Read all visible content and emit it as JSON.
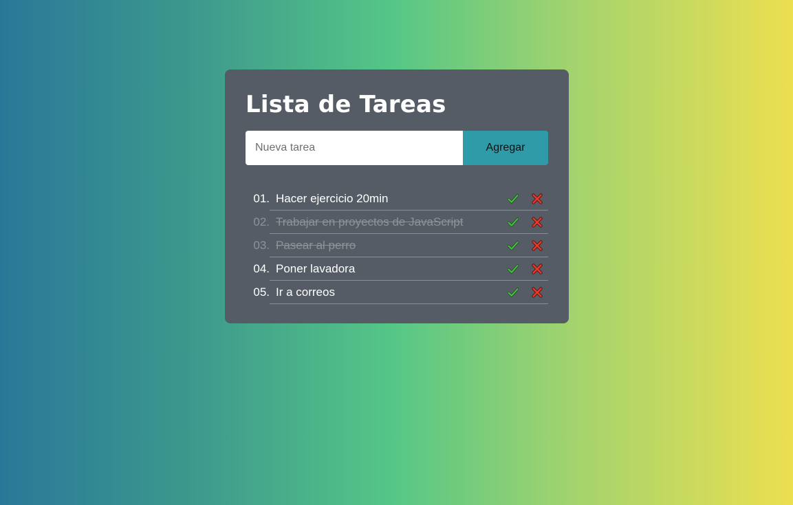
{
  "app": {
    "title": "Lista de Tareas"
  },
  "form": {
    "placeholder": "Nueva tarea",
    "value": "",
    "add_label": "Agregar"
  },
  "tasks": [
    {
      "number": "01.",
      "text": "Hacer ejercicio 20min",
      "done": false
    },
    {
      "number": "02.",
      "text": "Trabajar en proyectos de JavaScript",
      "done": true
    },
    {
      "number": "03.",
      "text": "Pasear al perro",
      "done": true
    },
    {
      "number": "04.",
      "text": "Poner lavadora",
      "done": false
    },
    {
      "number": "05.",
      "text": "Ir a correos",
      "done": false
    }
  ],
  "icons": {
    "complete": "check-icon",
    "delete": "close-icon"
  },
  "colors": {
    "card": "#555c65",
    "accent": "#2f9aa8",
    "check": "#3fbf3f",
    "delete": "#e53b2c"
  }
}
